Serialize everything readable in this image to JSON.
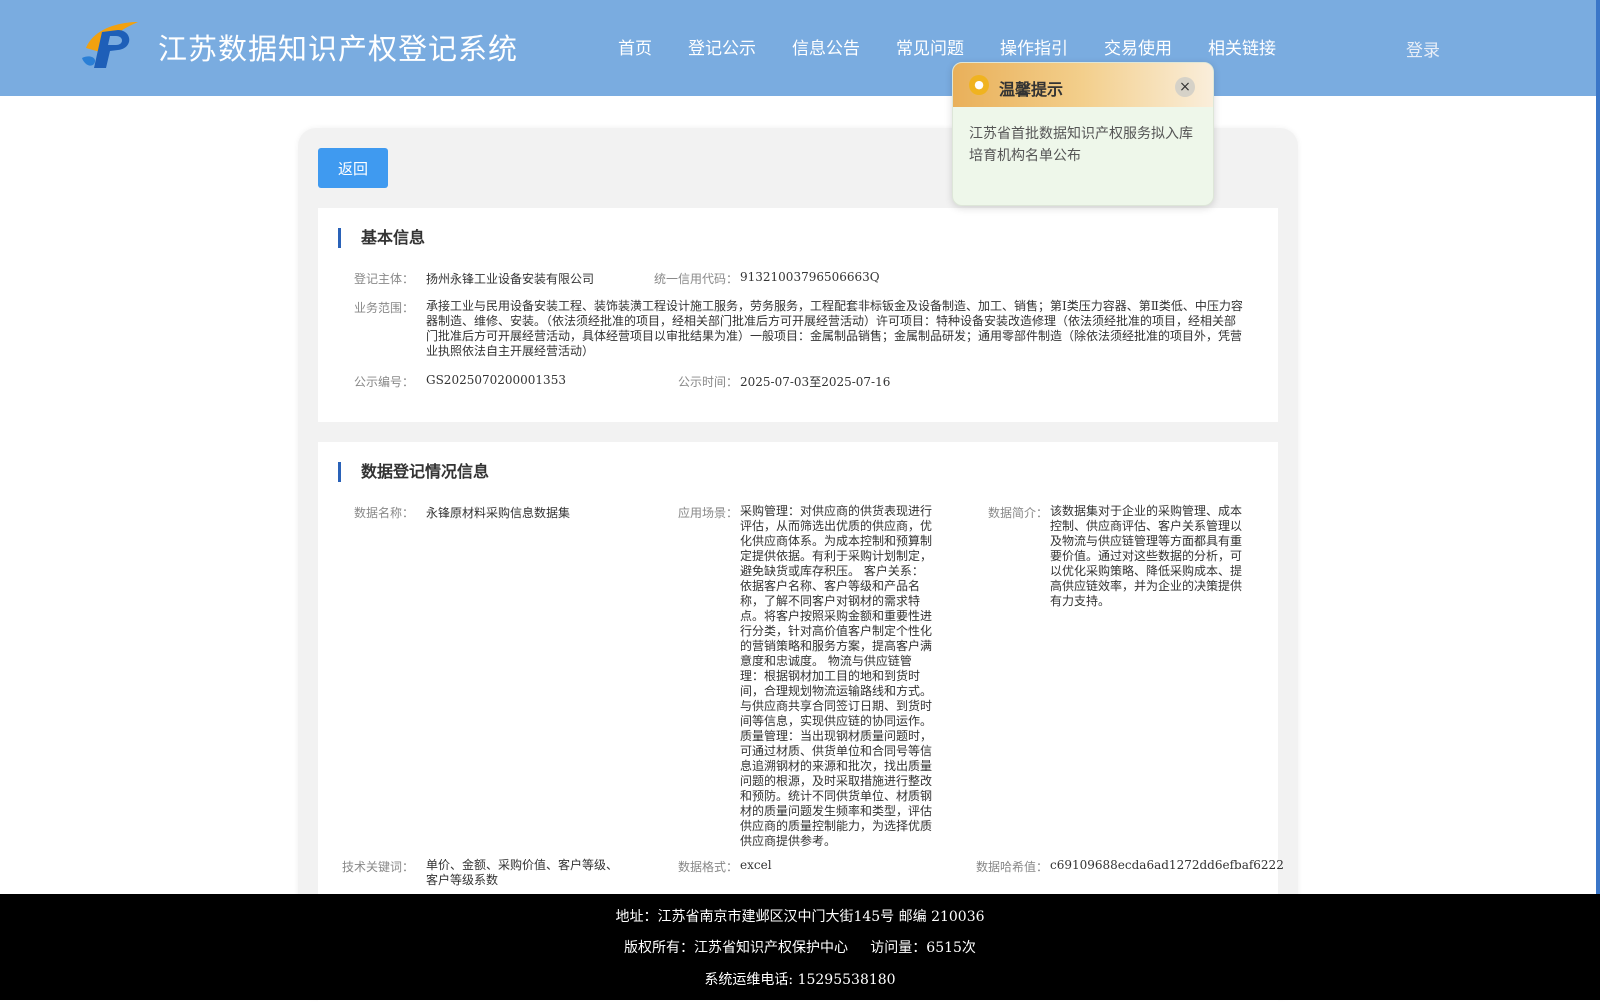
{
  "header": {
    "site_title": "江苏数据知识产权登记系统",
    "nav": [
      "首页",
      "登记公示",
      "信息公告",
      "常见问题",
      "操作指引",
      "交易使用",
      "相关链接"
    ],
    "login": "登录"
  },
  "colors": {
    "header_bg": "#7aace0",
    "button_blue": "#3f9af0",
    "section_bar": "#2a62b8",
    "footer_bg": "#000000"
  },
  "back_label": "返回",
  "basic": {
    "title": "基本信息",
    "entity_label": "登记主体：",
    "entity_value": "扬州永锋工业设备安装有限公司",
    "credit_label": "统一信用代码：",
    "credit_value": "91321003796506663Q",
    "scope_label": "业务范围：",
    "scope_value": "承接工业与民用设备安装工程、装饰装潢工程设计施工服务，劳务服务，工程配套非标钣金及设备制造、加工、销售；第Ⅰ类压力容器、第Ⅱ类低、中压力容器制造、维修、安装。（依法须经批准的项目，经相关部门批准后方可开展经营活动）许可项目：特种设备安装改造修理（依法须经批准的项目，经相关部门批准后方可开展经营活动，具体经营项目以审批结果为准）一般项目：金属制品销售；金属制品研发；通用零部件制造（除依法须经批准的项目外，凭营业执照依法自主开展经营活动）",
    "pub_no_label": "公示编号：",
    "pub_no_value": "GS2025070200001353",
    "pub_time_label": "公示时间：",
    "pub_time_value": "2025-07-03至2025-07-16"
  },
  "data_info": {
    "title": "数据登记情况信息",
    "name_label": "数据名称：",
    "name_value": "永锋原材料采购信息数据集",
    "scene_label": "应用场景：",
    "scene_value": "采购管理：对供应商的供货表现进行评估，从而筛选出优质的供应商，优化供应商体系。为成本控制和预算制定提供依据。有利于采购计划制定，避免缺货或库存积压。 客户关系：依据客户名称、客户等级和产品名称，了解不同客户对钢材的需求特点。将客户按照采购金额和重要性进行分类，针对高价值客户制定个性化的营销策略和服务方案，提高客户满意度和忠诚度。 物流与供应链管理：根据钢材加工目的地和到货时间，合理规划物流运输路线和方式。与供应商共享合同签订日期、到货时间等信息，实现供应链的协同运作。 质量管理：当出现钢材质量问题时，可通过材质、供货单位和合同号等信息追溯钢材的来源和批次，找出质量问题的根源，及时采取措施进行整改和预防。统计不同供货单位、材质钢材的质量问题发生频率和类型，评估供应商的质量控制能力，为选择优质供应商提供参考。",
    "intro_label": "数据简介：",
    "intro_value": "该数据集对于企业的采购管理、成本控制、供应商评估、客户关系管理以及物流与供应链管理等方面都具有重要价值。通过对这些数据的分析，可以优化采购策略、降低采购成本、提高供应链效率，并为企业的决策提供有力支持。",
    "keywords_label": "技术关键词：",
    "keywords_value": "单价、金额、采购价值、客户等级、客户等级系数",
    "format_label": "数据格式：",
    "format_value": "excel",
    "hash_label": "数据哈希值：",
    "hash_value": "c69109688ecda6ad1272dd6efbaf6222"
  },
  "popup": {
    "title": "温馨提示",
    "close": "×",
    "icon": "lightbulb-icon",
    "message": "江苏省首批数据知识产权服务拟入库培育机构名单公布"
  },
  "footer": {
    "address": "地址：江苏省南京市建邺区汉中门大街145号 邮编 210036",
    "copyright": "版权所有：江苏省知识产权保护中心     访问量：6515次",
    "phone": "系统运维电话: 15295538180"
  }
}
